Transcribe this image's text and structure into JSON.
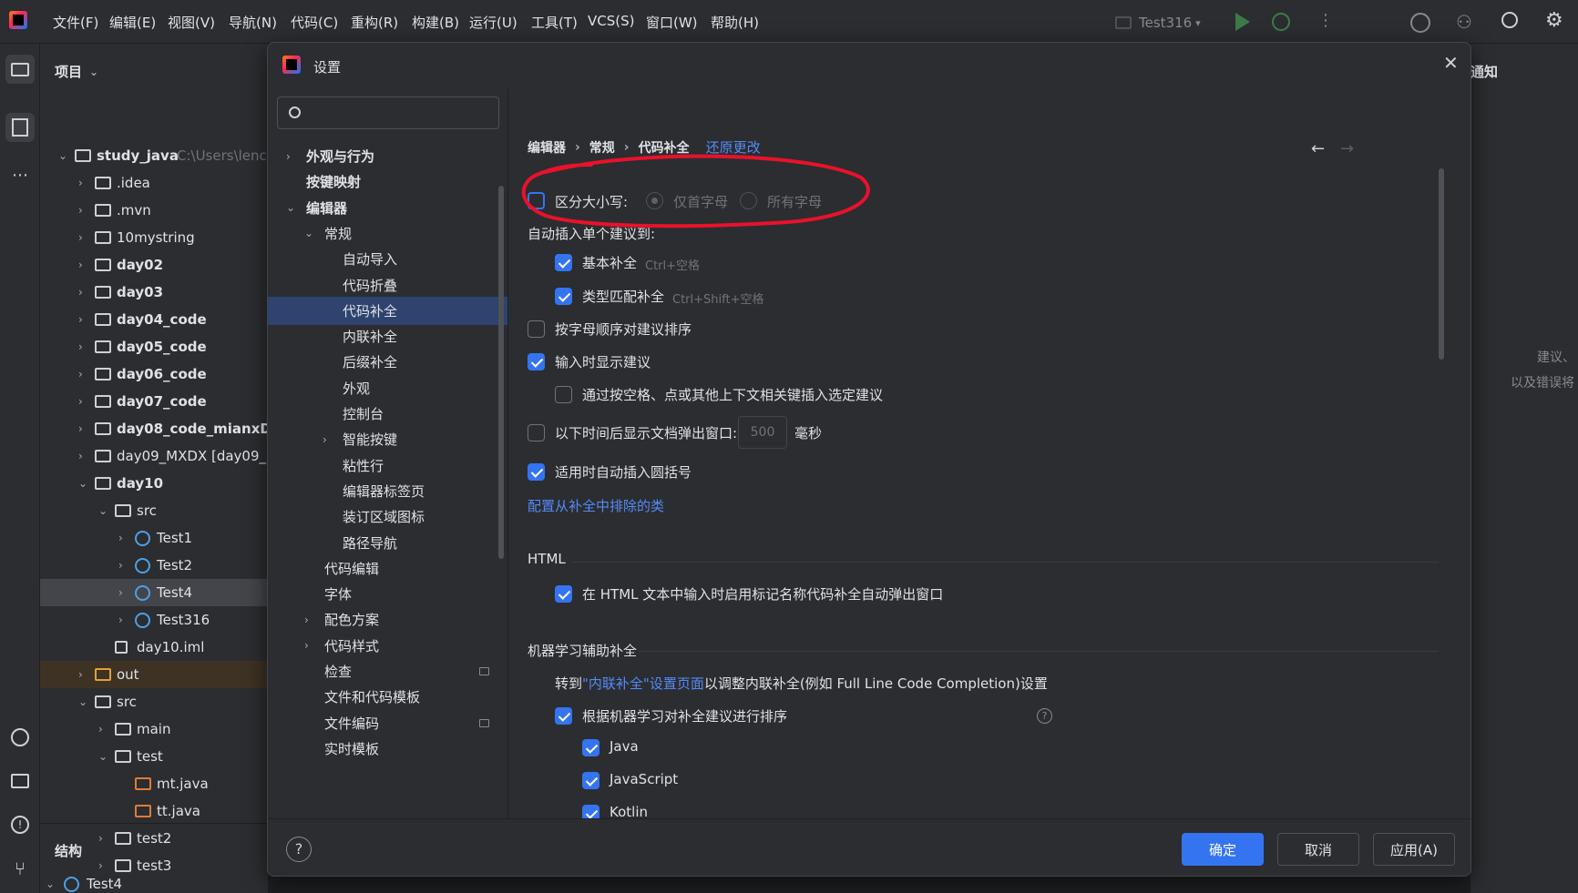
{
  "topbar": {
    "menu": [
      "文件(F)",
      "编辑(E)",
      "视图(V)",
      "导航(N)",
      "代码(C)",
      "重构(R)",
      "构建(B)",
      "运行(U)",
      "工具(T)",
      "VCS(S)",
      "窗口(W)",
      "帮助(H)"
    ],
    "run_config": "Test316"
  },
  "project": {
    "title": "项目",
    "tree": [
      {
        "label": "study_java",
        "extra": "C:\\Users\\lenc",
        "kind": "folder",
        "bold": true
      },
      {
        "label": ".idea",
        "kind": "folder"
      },
      {
        "label": ".mvn",
        "kind": "folder"
      },
      {
        "label": "10mystring",
        "kind": "folder"
      },
      {
        "label": "day02",
        "kind": "folder",
        "bold": true
      },
      {
        "label": "day03",
        "kind": "folder",
        "bold": true
      },
      {
        "label": "day04_code",
        "kind": "folder",
        "bold": true
      },
      {
        "label": "day05_code",
        "kind": "folder",
        "bold": true
      },
      {
        "label": "day06_code",
        "kind": "folder",
        "bold": true
      },
      {
        "label": "day07_code",
        "kind": "folder",
        "bold": true
      },
      {
        "label": "day08_code_mianxDU",
        "kind": "folder",
        "bold": true
      },
      {
        "label": "day09_MXDX [day09_",
        "kind": "folder"
      },
      {
        "label": "day10",
        "kind": "folder",
        "bold": true
      },
      {
        "label": "src",
        "kind": "folder"
      },
      {
        "label": "Test1",
        "kind": "class"
      },
      {
        "label": "Test2",
        "kind": "class"
      },
      {
        "label": "Test4",
        "kind": "class"
      },
      {
        "label": "Test316",
        "kind": "class"
      },
      {
        "label": "day10.iml",
        "kind": "file"
      },
      {
        "label": "out",
        "kind": "folder"
      },
      {
        "label": "src",
        "kind": "folder"
      },
      {
        "label": "main",
        "kind": "folder"
      },
      {
        "label": "test",
        "kind": "folder"
      },
      {
        "label": "mt.java",
        "kind": "java"
      },
      {
        "label": "tt.java",
        "kind": "java"
      },
      {
        "label": "test2",
        "kind": "folder"
      },
      {
        "label": "test3",
        "kind": "folder"
      }
    ],
    "structure_title": "结构",
    "structure_item": "Test4"
  },
  "right_panel": {
    "title": "通知",
    "text1": "建议、",
    "text2": "以及错误将"
  },
  "dialog": {
    "title": "设置",
    "search_placeholder": "",
    "nav": [
      {
        "label": "外观与行为",
        "bold": true,
        "chev": "›"
      },
      {
        "label": "按键映射",
        "bold": true,
        "chev": ""
      },
      {
        "label": "编辑器",
        "bold": true,
        "chev": "⌄"
      },
      {
        "label": "常规",
        "bold": false,
        "chev": "⌄"
      },
      {
        "label": "自动导入",
        "bold": false,
        "chev": ""
      },
      {
        "label": "代码折叠",
        "bold": false,
        "chev": ""
      },
      {
        "label": "代码补全",
        "bold": false,
        "chev": "",
        "selected": true
      },
      {
        "label": "内联补全",
        "bold": false,
        "chev": ""
      },
      {
        "label": "后缀补全",
        "bold": false,
        "chev": ""
      },
      {
        "label": "外观",
        "bold": false,
        "chev": ""
      },
      {
        "label": "控制台",
        "bold": false,
        "chev": ""
      },
      {
        "label": "智能按键",
        "bold": false,
        "chev": "›"
      },
      {
        "label": "粘性行",
        "bold": false,
        "chev": ""
      },
      {
        "label": "编辑器标签页",
        "bold": false,
        "chev": ""
      },
      {
        "label": "装订区域图标",
        "bold": false,
        "chev": ""
      },
      {
        "label": "路径导航",
        "bold": false,
        "chev": ""
      },
      {
        "label": "代码编辑",
        "bold": false,
        "chev": ""
      },
      {
        "label": "字体",
        "bold": false,
        "chev": ""
      },
      {
        "label": "配色方案",
        "bold": false,
        "chev": "›"
      },
      {
        "label": "代码样式",
        "bold": false,
        "chev": "›"
      },
      {
        "label": "检查",
        "bold": false,
        "chev": "",
        "badge": true
      },
      {
        "label": "文件和代码模板",
        "bold": false,
        "chev": ""
      },
      {
        "label": "文件编码",
        "bold": false,
        "chev": "",
        "badge": true
      },
      {
        "label": "实时模板",
        "bold": false,
        "chev": ""
      }
    ],
    "breadcrumb": [
      "编辑器",
      "常规",
      "代码补全"
    ],
    "reset_link": "还原更改",
    "case_sensitive": "区分大小写:",
    "radio_first": "仅首字母",
    "radio_all": "所有字母",
    "auto_insert_label": "自动插入单个建议到:",
    "basic_completion": "基本补全",
    "basic_shortcut": "Ctrl+空格",
    "type_completion": "类型匹配补全",
    "type_shortcut": "Ctrl+Shift+空格",
    "sort_alpha": "按字母顺序对建议排序",
    "show_on_typing": "输入时显示建议",
    "insert_by_space": "通过按空格、点或其他上下文相关键插入选定建议",
    "doc_popup": "以下时间后显示文档弹出窗口:",
    "doc_popup_value": "500",
    "doc_popup_unit": "毫秒",
    "auto_paren": "适用时自动插入圆括号",
    "exclude_link": "配置从补全中排除的类",
    "html_section": "HTML",
    "html_option": "在 HTML 文本中输入时启用标记名称代码补全自动弹出窗口",
    "ml_section": "机器学习辅助补全",
    "ml_goto_prefix": "转到",
    "ml_goto_link": "\"内联补全\"设置页面",
    "ml_goto_suffix": "以调整内联补全(例如 Full Line Code Completion)设置",
    "ml_sort": "根据机器学习对补全建议进行排序",
    "langs": [
      {
        "label": "Java",
        "checked": true
      },
      {
        "label": "JavaScript",
        "checked": true
      },
      {
        "label": "Kotlin",
        "checked": true
      },
      {
        "label": "SQL",
        "checked": false
      }
    ],
    "ok": "确定",
    "cancel": "取消",
    "apply": "应用(A)"
  },
  "colors": {
    "accent": "#3574f0",
    "annotation": "#e8122a",
    "link": "#548af7"
  }
}
